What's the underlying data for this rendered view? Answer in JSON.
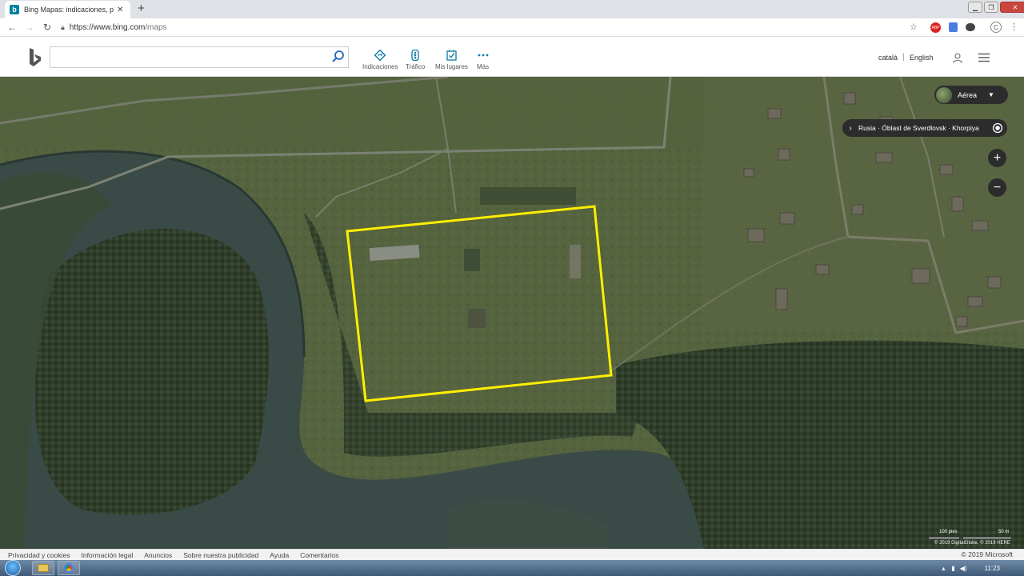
{
  "browser": {
    "tab_title": "Bing Mapas: indicaciones, planific",
    "tab_close": "✕",
    "new_tab": "+",
    "url_host": "https://www.bing.com",
    "url_path": "/maps"
  },
  "header": {
    "search_value": "",
    "nav": [
      {
        "label": "Indicaciones",
        "icon": "directions-icon"
      },
      {
        "label": "Tráfico",
        "icon": "traffic-icon"
      },
      {
        "label": "Mis lugares",
        "icon": "my-places-icon"
      },
      {
        "label": "Más",
        "icon": "more-icon"
      }
    ],
    "lang1": "català",
    "lang_sep": "|",
    "lang2": "English"
  },
  "map": {
    "style_label": "Aérea",
    "breadcrumb": "Rusia · Óblast de Sverdlovsk · Khorpiya",
    "zoom_in": "+",
    "zoom_out": "−",
    "scale_ft": "100 pies",
    "scale_m": "50 m",
    "imagery_credit": "© 2019 DigitalGlobe, © 2019 HERE",
    "highlight_color": "#ffee00"
  },
  "footer": {
    "links": [
      "Privacidad y cookies",
      "Información legal",
      "Anuncios",
      "Sobre nuestra publicidad",
      "Ayuda",
      "Comentarios"
    ],
    "copyright": "© 2019 Microsoft"
  },
  "taskbar": {
    "clock": "11:23"
  }
}
